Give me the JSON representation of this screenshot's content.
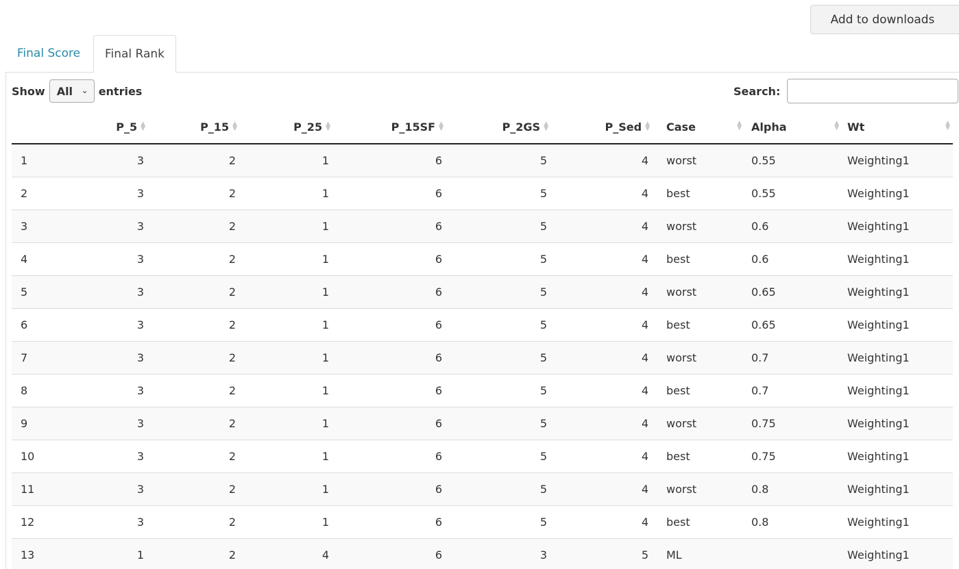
{
  "toolbar": {
    "download_label": "Add to downloads"
  },
  "tabs": [
    {
      "label": "Final Score",
      "active": false
    },
    {
      "label": "Final Rank",
      "active": true
    }
  ],
  "controls": {
    "show_label": "Show",
    "entries_value": "All",
    "entries_label": "entries",
    "search_label": "Search:",
    "search_value": ""
  },
  "table": {
    "columns": [
      "",
      "P_5",
      "P_15",
      "P_25",
      "P_15SF",
      "P_2GS",
      "P_Sed",
      "Case",
      "Alpha",
      "Wt"
    ],
    "rows": [
      [
        "1",
        "3",
        "2",
        "1",
        "6",
        "5",
        "4",
        "worst",
        "0.55",
        "Weighting1"
      ],
      [
        "2",
        "3",
        "2",
        "1",
        "6",
        "5",
        "4",
        "best",
        "0.55",
        "Weighting1"
      ],
      [
        "3",
        "3",
        "2",
        "1",
        "6",
        "5",
        "4",
        "worst",
        "0.6",
        "Weighting1"
      ],
      [
        "4",
        "3",
        "2",
        "1",
        "6",
        "5",
        "4",
        "best",
        "0.6",
        "Weighting1"
      ],
      [
        "5",
        "3",
        "2",
        "1",
        "6",
        "5",
        "4",
        "worst",
        "0.65",
        "Weighting1"
      ],
      [
        "6",
        "3",
        "2",
        "1",
        "6",
        "5",
        "4",
        "best",
        "0.65",
        "Weighting1"
      ],
      [
        "7",
        "3",
        "2",
        "1",
        "6",
        "5",
        "4",
        "worst",
        "0.7",
        "Weighting1"
      ],
      [
        "8",
        "3",
        "2",
        "1",
        "6",
        "5",
        "4",
        "best",
        "0.7",
        "Weighting1"
      ],
      [
        "9",
        "3",
        "2",
        "1",
        "6",
        "5",
        "4",
        "worst",
        "0.75",
        "Weighting1"
      ],
      [
        "10",
        "3",
        "2",
        "1",
        "6",
        "5",
        "4",
        "best",
        "0.75",
        "Weighting1"
      ],
      [
        "11",
        "3",
        "2",
        "1",
        "6",
        "5",
        "4",
        "worst",
        "0.8",
        "Weighting1"
      ],
      [
        "12",
        "3",
        "2",
        "1",
        "6",
        "5",
        "4",
        "best",
        "0.8",
        "Weighting1"
      ],
      [
        "13",
        "1",
        "2",
        "4",
        "6",
        "3",
        "5",
        "ML",
        "",
        "Weighting1"
      ]
    ]
  },
  "colors": {
    "tab_link": "#2a8aa8",
    "header_rule": "#222222",
    "stripe": "#f9f9f9"
  }
}
